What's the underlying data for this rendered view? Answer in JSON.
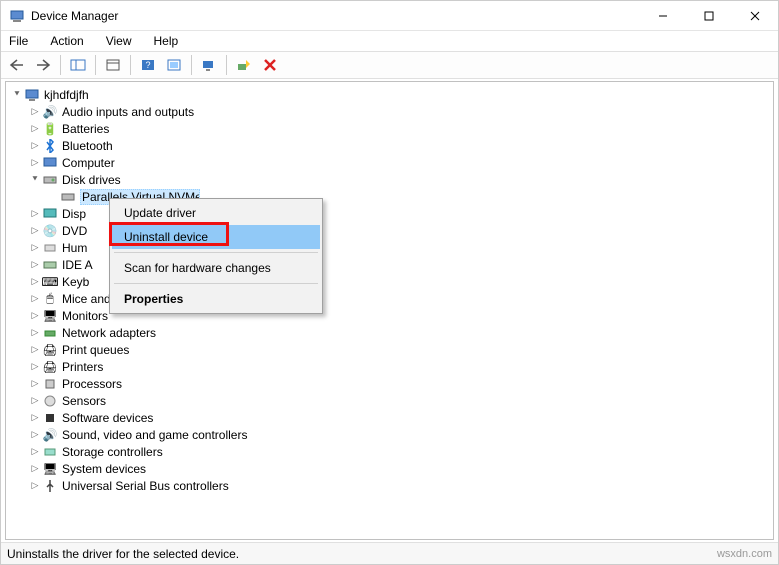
{
  "window": {
    "title": "Device Manager"
  },
  "menu": {
    "file": "File",
    "action": "Action",
    "view": "View",
    "help": "Help"
  },
  "tree": {
    "root": "kjhdfdjfh",
    "audio": "Audio inputs and outputs",
    "batteries": "Batteries",
    "bluetooth": "Bluetooth",
    "computer": "Computer",
    "disk_drives": "Disk drives",
    "disk_child": "Parallels Virtual NVMe Disk",
    "display": "Display adapters",
    "dvd": "DVD/CD-ROM drives",
    "hid": "Human Interface Devices",
    "ide": "IDE ATA/ATAPI controllers",
    "keyboards": "Keyboards",
    "mice": "Mice and other pointing devices",
    "monitors": "Monitors",
    "network": "Network adapters",
    "printq": "Print queues",
    "printers": "Printers",
    "processors": "Processors",
    "sensors": "Sensors",
    "software": "Software devices",
    "sound": "Sound, video and game controllers",
    "storage": "Storage controllers",
    "system": "System devices",
    "usb": "Universal Serial Bus controllers"
  },
  "context_menu": {
    "update": "Update driver",
    "uninstall": "Uninstall device",
    "scan": "Scan for hardware changes",
    "properties": "Properties"
  },
  "status": {
    "text": "Uninstalls the driver for the selected device."
  },
  "watermark": "wsxdn.com"
}
